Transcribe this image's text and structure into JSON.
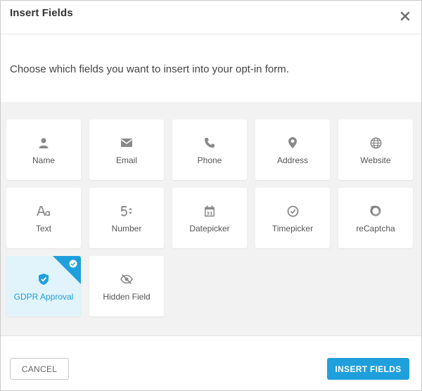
{
  "header": {
    "title": "Insert Fields",
    "close_icon": "close-icon"
  },
  "description": "Choose which fields you want to insert into your opt-in form.",
  "fields": [
    {
      "label": "Name",
      "icon": "user-icon",
      "selected": false
    },
    {
      "label": "Email",
      "icon": "envelope-icon",
      "selected": false
    },
    {
      "label": "Phone",
      "icon": "phone-icon",
      "selected": false
    },
    {
      "label": "Address",
      "icon": "map-pin-icon",
      "selected": false
    },
    {
      "label": "Website",
      "icon": "globe-icon",
      "selected": false
    },
    {
      "label": "Text",
      "icon": "text-font-icon",
      "selected": false
    },
    {
      "label": "Number",
      "icon": "number-stepper-icon",
      "selected": false
    },
    {
      "label": "Datepicker",
      "icon": "calendar-icon",
      "selected": false
    },
    {
      "label": "Timepicker",
      "icon": "clock-icon",
      "selected": false
    },
    {
      "label": "reCaptcha",
      "icon": "recaptcha-icon",
      "selected": false
    },
    {
      "label": "GDPR Approval",
      "icon": "shield-check-icon",
      "selected": true
    },
    {
      "label": "Hidden Field",
      "icon": "eye-slash-icon",
      "selected": false
    }
  ],
  "footer": {
    "cancel_label": "CANCEL",
    "insert_label": "INSERT FIELDS"
  },
  "colors": {
    "accent": "#1fa0dc",
    "selected_tile_bg": "#e1f3fb",
    "selected_label": "#1f9fd5"
  }
}
